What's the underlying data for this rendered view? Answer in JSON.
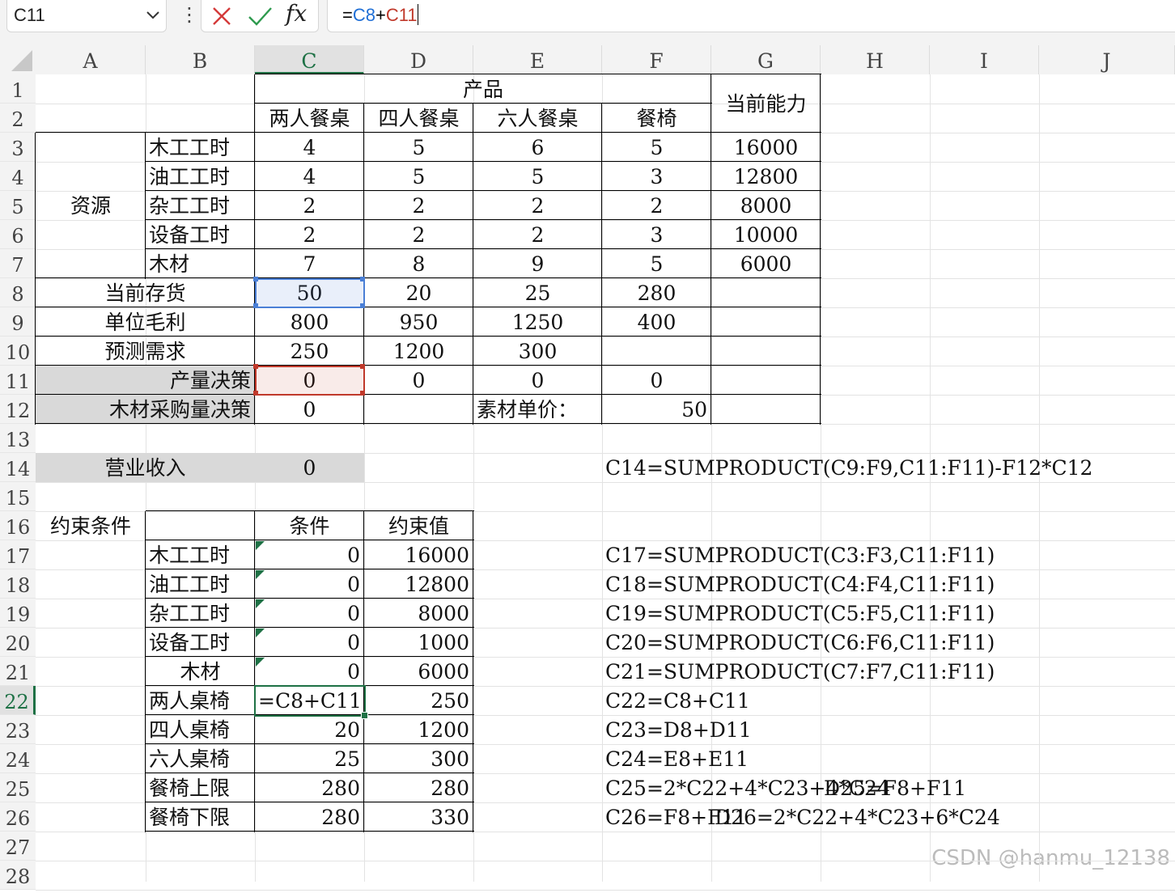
{
  "formula_bar": {
    "name_box": "C11",
    "name_dropdown_icon": "chevron-down",
    "more_icon": "⋮",
    "cancel_icon": "✕",
    "enter_icon": "✓",
    "function_label": "fx",
    "formula_parts": [
      "=",
      "C8",
      "+",
      "C11"
    ],
    "ref_colors": {
      "C8": "#1f6fd6",
      "C11": "#c0392b"
    }
  },
  "grid": {
    "columns": [
      "A",
      "B",
      "C",
      "D",
      "E",
      "F",
      "G",
      "H",
      "I",
      "J"
    ],
    "rows": [
      "1",
      "2",
      "3",
      "4",
      "5",
      "6",
      "7",
      "8",
      "9",
      "10",
      "11",
      "12",
      "13",
      "14",
      "15",
      "16",
      "17",
      "18",
      "19",
      "20",
      "21",
      "22",
      "23",
      "24",
      "25",
      "26",
      "27",
      "28"
    ],
    "active_column": "C",
    "active_row": "22",
    "selected_cell": "C22",
    "highlight_colors": {
      "blue_ref": "#4a7fd6",
      "red_ref": "#c0392b",
      "active": "#1e7145",
      "label_fill": "#d9d9d9"
    }
  },
  "cells": {
    "C1": "产品",
    "G1": "当前能力",
    "C2": "两人餐桌",
    "D2": "四人餐桌",
    "E2": "六人餐桌",
    "F2": "餐椅",
    "A5": "资源",
    "B3": "木工工时",
    "C3": "4",
    "D3": "5",
    "E3": "6",
    "F3": "5",
    "G3": "16000",
    "B4": "油工工时",
    "C4": "4",
    "D4": "5",
    "E4": "5",
    "F4": "3",
    "G4": "12800",
    "B5": "杂工工时",
    "C5": "2",
    "D5": "2",
    "E5": "2",
    "F5": "2",
    "G5": "8000",
    "B6": "设备工时",
    "C6": "2",
    "D6": "2",
    "E6": "2",
    "F6": "3",
    "G6": "10000",
    "B7": "木材",
    "C7": "7",
    "D7": "8",
    "E7": "9",
    "F7": "5",
    "G7": "6000",
    "A8": "当前存货",
    "C8": "50",
    "D8": "20",
    "E8": "25",
    "F8": "280",
    "A9": "单位毛利",
    "C9": "800",
    "D9": "950",
    "E9": "1250",
    "F9": "400",
    "A10": "预测需求",
    "C10": "250",
    "D10": "1200",
    "E10": "300",
    "A11": "产量决策",
    "C11": "0",
    "D11": "0",
    "E11": "0",
    "F11": "0",
    "A12": "木材采购量决策",
    "C12": "0",
    "E12": "素材单价：",
    "F12": "50",
    "A14": "营业收入",
    "C14": "0",
    "F14": "C14=SUMPRODUCT(C9:F9,C11:F11)-F12*C12",
    "A16": "约束条件",
    "C16": "条件",
    "D16": "约束值",
    "B17": "木工工时",
    "C17": "0",
    "D17": "16000",
    "F17": "C17=SUMPRODUCT(C3:F3,C11:F11)",
    "B18": "油工工时",
    "C18": "0",
    "D18": "12800",
    "F18": "C18=SUMPRODUCT(C4:F4,C11:F11)",
    "B19": "杂工工时",
    "C19": "0",
    "D19": "8000",
    "F19": "C19=SUMPRODUCT(C5:F5,C11:F11)",
    "B20": "设备工时",
    "C20": "0",
    "D20": "1000",
    "F20": "C20=SUMPRODUCT(C6:F6,C11:F11)",
    "B21": "木材",
    "C21": "0",
    "D21": "6000",
    "F21": "C21=SUMPRODUCT(C7:F7,C11:F11)",
    "B22": "两人桌椅",
    "C22": "=C8+C11",
    "D22": "250",
    "F22": "C22=C8+C11",
    "B23": "四人桌椅",
    "C23": "20",
    "D23": "1200",
    "F23": "C23=D8+D11",
    "B24": "六人桌椅",
    "C24": "25",
    "D24": "300",
    "F24": "C24=E8+E11",
    "B25": "餐椅上限",
    "C25": "280",
    "D25": "280",
    "F25": "C25=2*C22+4*C23+4*C24",
    "H25": "D25=F8+F11",
    "B26": "餐椅下限",
    "C26": "280",
    "D26": "330",
    "F26": "C26=F8+F11",
    "G26": "D26=2*C22+4*C23+6*C24"
  },
  "watermark": "CSDN @hanmu_12138"
}
